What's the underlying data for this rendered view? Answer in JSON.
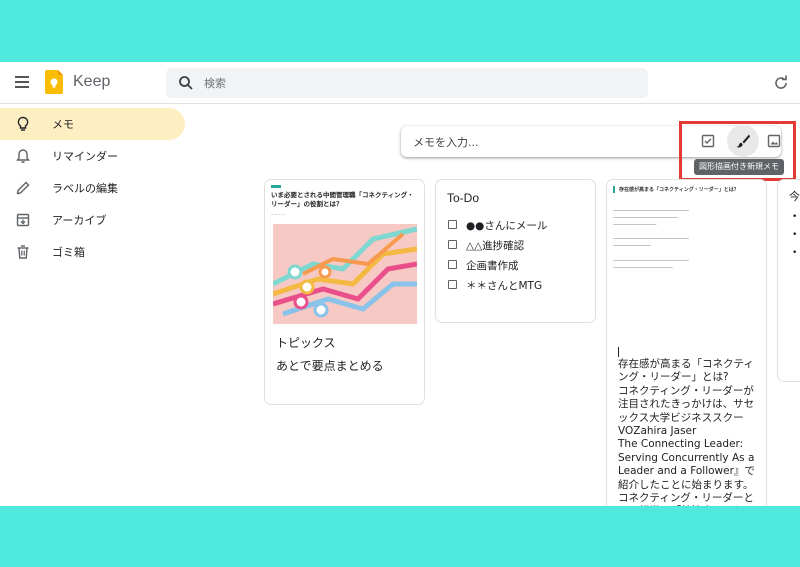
{
  "header": {
    "app_name": "Keep",
    "search_placeholder": "検索"
  },
  "sidebar": {
    "items": [
      {
        "label": "メモ",
        "icon": "lightbulb-icon",
        "active": true
      },
      {
        "label": "リマインダー",
        "icon": "bell-icon",
        "active": false
      },
      {
        "label": "ラベルの編集",
        "icon": "pencil-icon",
        "active": false
      },
      {
        "label": "アーカイブ",
        "icon": "archive-icon",
        "active": false
      },
      {
        "label": "ゴミ箱",
        "icon": "trash-icon",
        "active": false
      }
    ]
  },
  "take_note": {
    "placeholder": "メモを入力...",
    "tooltip": "図形描画付き新規メモ"
  },
  "notes": {
    "card1": {
      "article_title": "いま必要とされる中間管理職「コネクティング・リーダー」の役割とは？",
      "title": "トピックス",
      "body": "あとで要点まとめる"
    },
    "card2": {
      "title": "To-Do",
      "items": [
        "●●さんにメール",
        "△△進捗確認",
        "企画書作成",
        "＊＊さんとMTG"
      ]
    },
    "card3": {
      "article_title": "存在感が高まる「コネクティング・リーダー」とは？",
      "text": "存在感が高まる「コネクティング・リーダー」とは?\nコネクティング・リーダーが注目されたきっかけは、サセックス大学ビジネススクーVOZahira Jaser\nThe Connecting Leader: Serving Concurrently As a\nLeader and a Follower』で紹介したことに始まります。\nコネクティング・リーダーとは、組織の「結節点」として、組織を良い方向に導くために働きかけるリーダーのこと。\nまた時は部下の意見を上司に進"
    },
    "card4": {
      "title": "今"
    }
  },
  "colors": {
    "active_nav_bg": "#feefc3",
    "highlight_border": "#e53935",
    "backdrop": "#4ee9dc"
  }
}
